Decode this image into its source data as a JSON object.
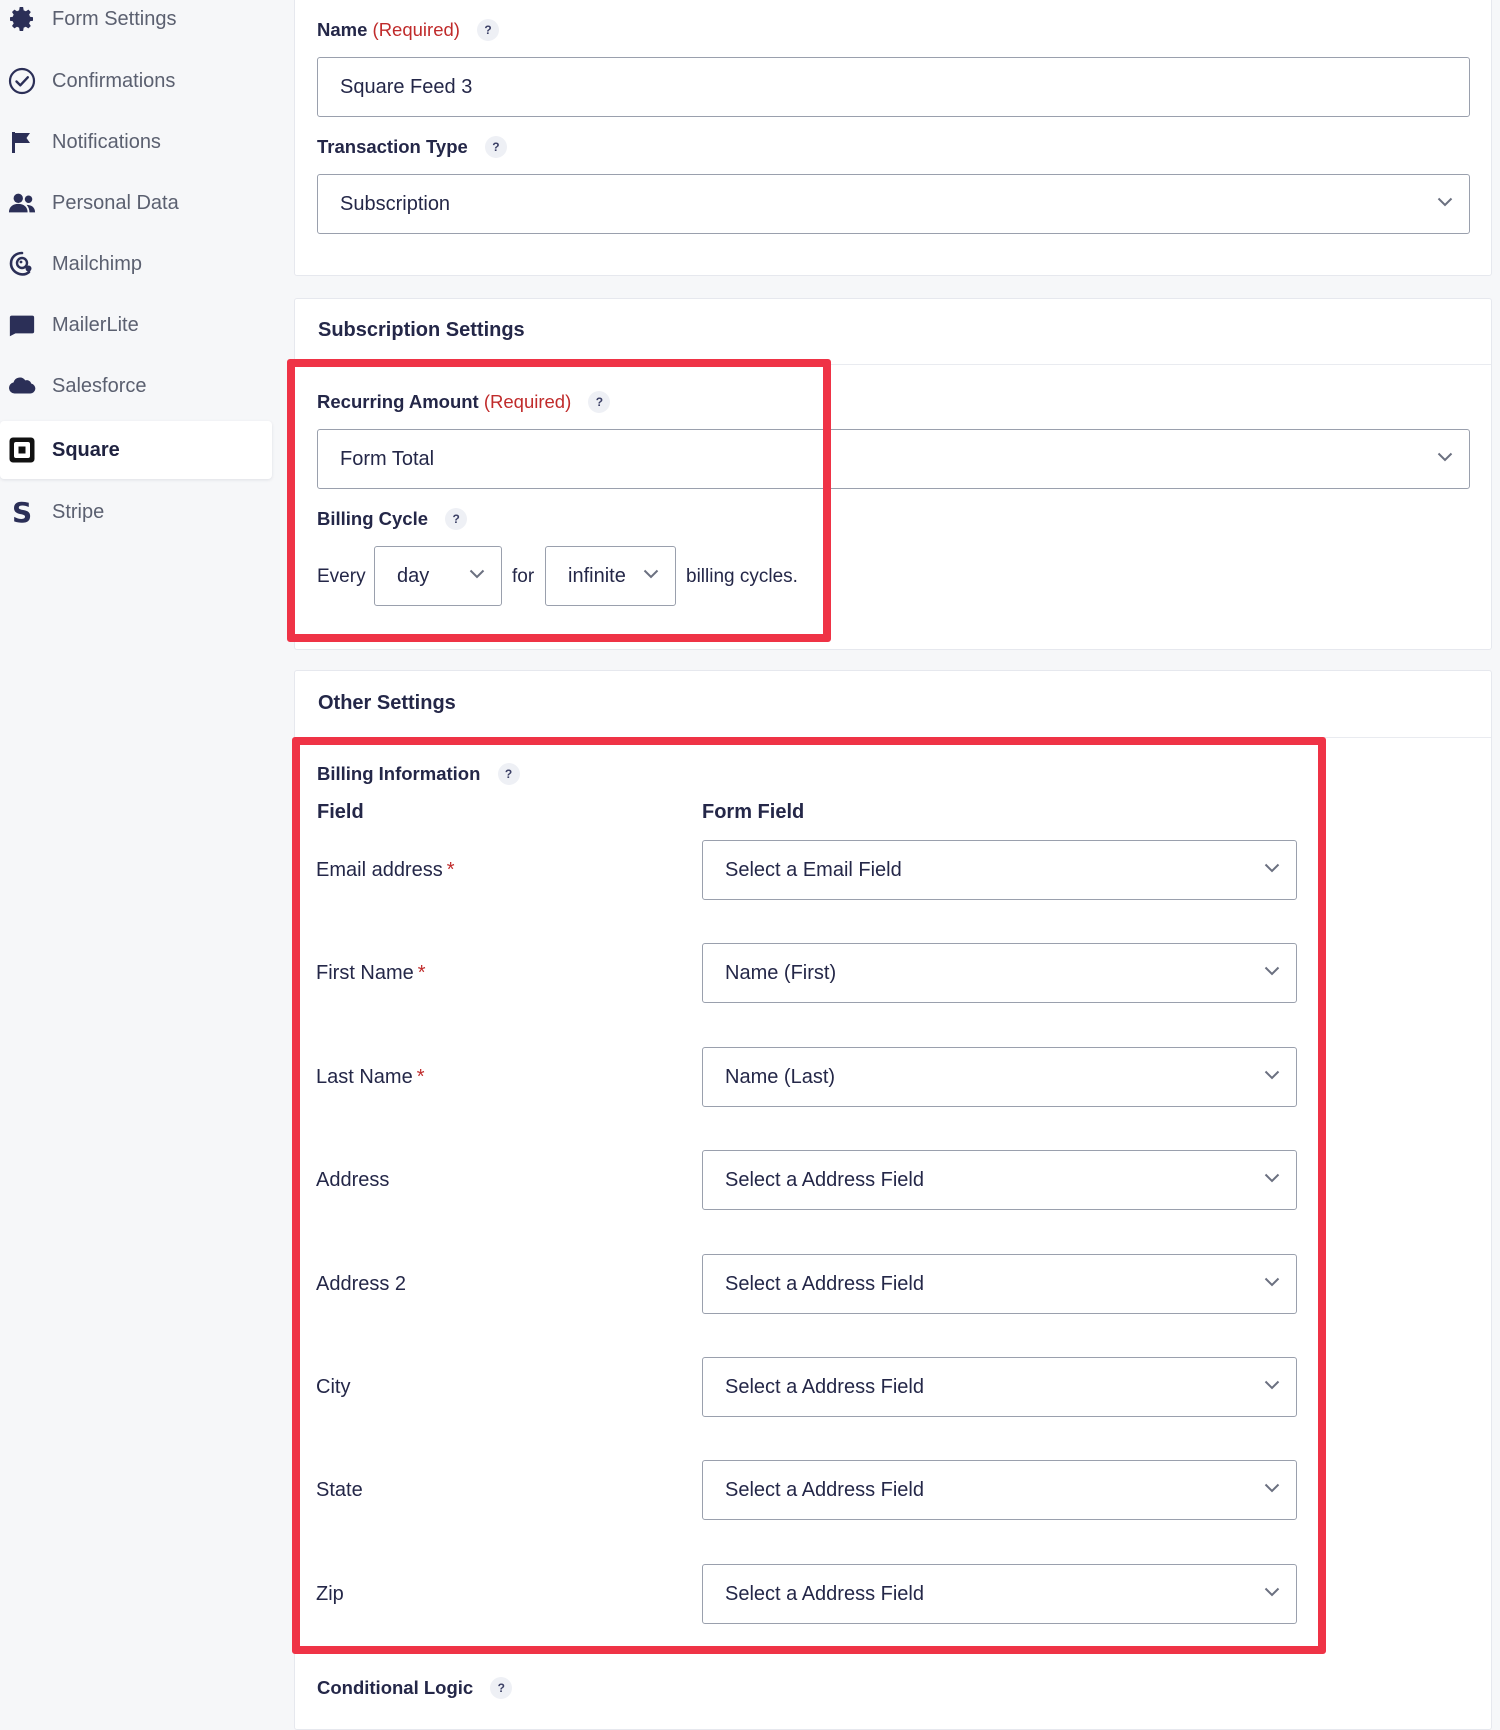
{
  "sidebar": {
    "items": [
      {
        "label": "Form Settings",
        "icon": "gear-icon"
      },
      {
        "label": "Confirmations",
        "icon": "check-circle-icon"
      },
      {
        "label": "Notifications",
        "icon": "flag-icon"
      },
      {
        "label": "Personal Data",
        "icon": "users-icon"
      },
      {
        "label": "Mailchimp",
        "icon": "mailchimp-icon"
      },
      {
        "label": "MailerLite",
        "icon": "chat-bubble-icon"
      },
      {
        "label": "Salesforce",
        "icon": "cloud-icon"
      },
      {
        "label": "Square",
        "icon": "square-logo-icon",
        "active": true
      },
      {
        "label": "Stripe",
        "icon": "stripe-s-icon"
      }
    ]
  },
  "feed": {
    "name_label": "Name",
    "name_required": "(Required)",
    "name_value": "Square Feed 3",
    "transaction_type_label": "Transaction Type",
    "transaction_type_value": "Subscription"
  },
  "subscription": {
    "title": "Subscription Settings",
    "recurring_amount_label": "Recurring Amount",
    "recurring_amount_required": "(Required)",
    "recurring_amount_value": "Form Total",
    "billing_cycle_label": "Billing Cycle",
    "every_text": "Every",
    "interval_value": "day",
    "for_text": "for",
    "cycles_value": "infinite",
    "billing_cycles_text": "billing cycles."
  },
  "other": {
    "title": "Other Settings",
    "billing_info_label": "Billing Information",
    "col_field": "Field",
    "col_form_field": "Form Field",
    "rows": [
      {
        "label": "Email address",
        "required": true,
        "value": "Select a Email Field"
      },
      {
        "label": "First Name",
        "required": true,
        "value": "Name (First)"
      },
      {
        "label": "Last Name",
        "required": true,
        "value": "Name (Last)"
      },
      {
        "label": "Address",
        "required": false,
        "value": "Select a Address Field"
      },
      {
        "label": "Address 2",
        "required": false,
        "value": "Select a Address Field"
      },
      {
        "label": "City",
        "required": false,
        "value": "Select a Address Field"
      },
      {
        "label": "State",
        "required": false,
        "value": "Select a Address Field"
      },
      {
        "label": "Zip",
        "required": false,
        "value": "Select a Address Field"
      }
    ],
    "conditional_logic_label": "Conditional Logic"
  },
  "help_glyph": "?",
  "required_star": "*",
  "colors": {
    "highlight": "#ef3346",
    "required": "#c02b2b",
    "text": "#242748"
  }
}
